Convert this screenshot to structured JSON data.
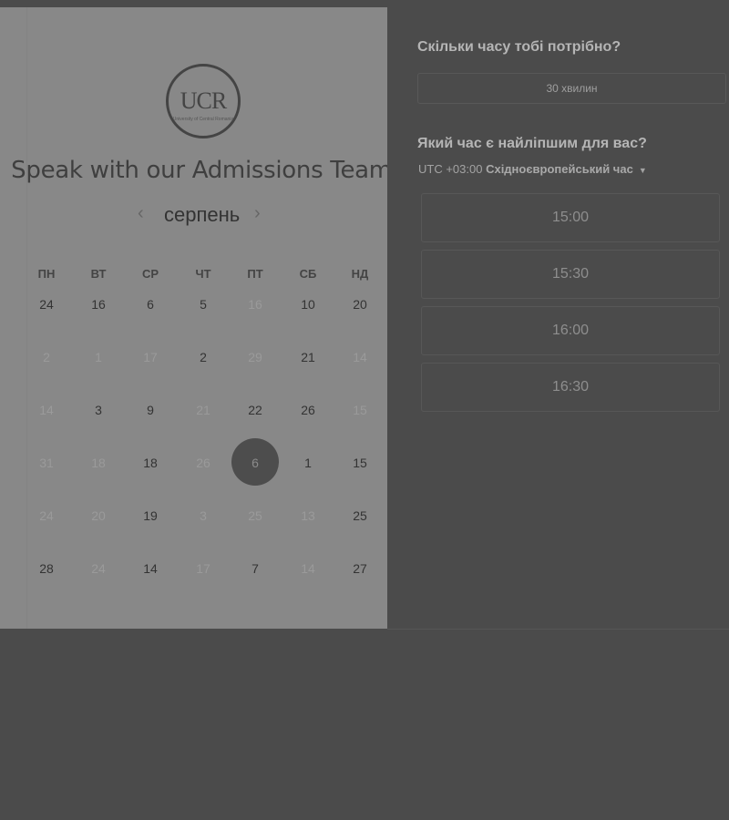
{
  "logo": {
    "text": "UCR",
    "subtext": "University of Central Romania"
  },
  "title": "Speak with our Admissions Team",
  "calendar": {
    "month": "серпень",
    "prev_icon": "chevron-left-icon",
    "next_icon": "chevron-right-icon",
    "weekdays": [
      "ПН",
      "ВТ",
      "СР",
      "ЧТ",
      "ПТ",
      "СБ",
      "НД"
    ],
    "rows": [
      [
        {
          "d": "24"
        },
        {
          "d": "16"
        },
        {
          "d": "6"
        },
        {
          "d": "5"
        },
        {
          "d": "16",
          "m": true
        },
        {
          "d": "10"
        },
        {
          "d": "20"
        }
      ],
      [
        {
          "d": "2",
          "m": true
        },
        {
          "d": "1",
          "m": true
        },
        {
          "d": "17",
          "m": true
        },
        {
          "d": "2"
        },
        {
          "d": "29",
          "m": true
        },
        {
          "d": "21"
        },
        {
          "d": "14",
          "m": true
        }
      ],
      [
        {
          "d": "14",
          "m": true
        },
        {
          "d": "3"
        },
        {
          "d": "9"
        },
        {
          "d": "21",
          "m": true
        },
        {
          "d": "22"
        },
        {
          "d": "26"
        },
        {
          "d": "15",
          "m": true
        }
      ],
      [
        {
          "d": "31",
          "m": true
        },
        {
          "d": "18",
          "m": true
        },
        {
          "d": "18"
        },
        {
          "d": "26",
          "m": true
        },
        {
          "d": "6",
          "sel": true
        },
        {
          "d": "1"
        },
        {
          "d": "15"
        }
      ],
      [
        {
          "d": "24",
          "m": true
        },
        {
          "d": "20",
          "m": true
        },
        {
          "d": "19"
        },
        {
          "d": "3",
          "m": true
        },
        {
          "d": "25",
          "m": true
        },
        {
          "d": "13",
          "m": true
        },
        {
          "d": "25"
        }
      ],
      [
        {
          "d": "28"
        },
        {
          "d": "24",
          "m": true
        },
        {
          "d": "14"
        },
        {
          "d": "17",
          "m": true
        },
        {
          "d": "7"
        },
        {
          "d": "14",
          "m": true
        },
        {
          "d": "27"
        }
      ]
    ]
  },
  "duration": {
    "question": "Скільки часу тобі потрібно?",
    "option": "30 хвилин"
  },
  "time": {
    "question": "Який час є найліпшим для вас?",
    "tz_offset": "UTC +03:00",
    "tz_name": "Східноєвропейський час",
    "slots": [
      "15:00",
      "15:30",
      "16:00",
      "16:30"
    ]
  }
}
